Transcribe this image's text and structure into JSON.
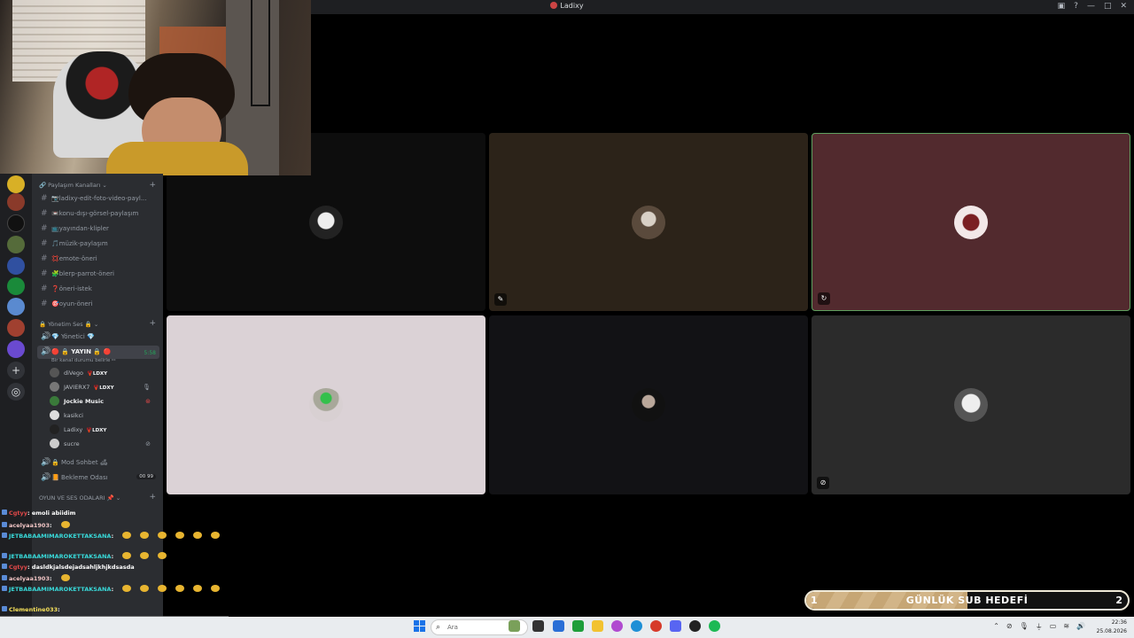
{
  "window": {
    "title": "Ladixy"
  },
  "sidebar": {
    "categories": [
      {
        "label": "Paylaşım Kanalları"
      },
      {
        "label": "Yönetim Ses 🔒"
      },
      {
        "label": "OYUN VE SES ODALARI 📌"
      }
    ],
    "text_channels": [
      "📷ladixy-edit-foto-video-payl...",
      "📼konu-dışı-görsel-paylaşım",
      "📺yayından-klipler",
      "🎵müzik-paylaşım",
      "💢emote-öneri",
      "🧩blerp-parrot-öneri",
      "❓öneri-istek",
      "🎯oyun-öneri"
    ],
    "voice_channels": {
      "yonetici": "💎 Yönetici 💎",
      "yayin": "🔴 🔒 YAYIN 🔒 🔴",
      "yayin_timer": "5:58",
      "yayin_status": "Bir kanal durumu belirle ✏",
      "mod": "🔒 Mod Sohbet 🛋",
      "bekleme": "📙 Bekleme Odası",
      "bekleme_count": "00 99"
    },
    "voice_users": [
      {
        "name": "diVego",
        "tag": "🦞LDXY"
      },
      {
        "name": "JAVIERX7",
        "tag": "🦞LDXY"
      },
      {
        "name": "Jockie Music",
        "tag": ""
      },
      {
        "name": "kasikci",
        "tag": ""
      },
      {
        "name": "Ladixy",
        "tag": "🦞LDXY"
      },
      {
        "name": "sucre",
        "tag": ""
      }
    ]
  },
  "chat": {
    "messages": [
      {
        "user": "Cgtyy",
        "text": ": emoli abiidim",
        "color": "#e04848"
      },
      {
        "user": "acelyaa1903",
        "text": ":",
        "color": "#f0c4c4"
      },
      {
        "user": "JETBABAAMIMAROKETTAKSANA",
        "text": ":",
        "color": "#38d9d9"
      },
      {
        "user": "JETBABAAMIMAROKETTAKSANA",
        "text": ":",
        "color": "#38d9d9"
      },
      {
        "user": "Cgtyy",
        "text": ": dasldkjalsdejadsahljkhjkdsasda",
        "color": "#e04848"
      },
      {
        "user": "acelyaa1903",
        "text": ":",
        "color": "#f0c4c4"
      },
      {
        "user": "JETBABAAMIMAROKETTAKSANA",
        "text": ":",
        "color": "#38d9d9"
      },
      {
        "user": "Clementine033",
        "text": ":",
        "color": "#f5e05a"
      }
    ]
  },
  "goal": {
    "label": "GÜNLÜK SUB HEDEFİ",
    "current": "1",
    "target": "2",
    "progress": 0.5
  },
  "taskbar": {
    "search_placeholder": "Ara",
    "time": "22:36",
    "date": "25.08.2026"
  },
  "colors": {
    "speaking": "#23a55a",
    "tile_selected": "#522a2e"
  }
}
